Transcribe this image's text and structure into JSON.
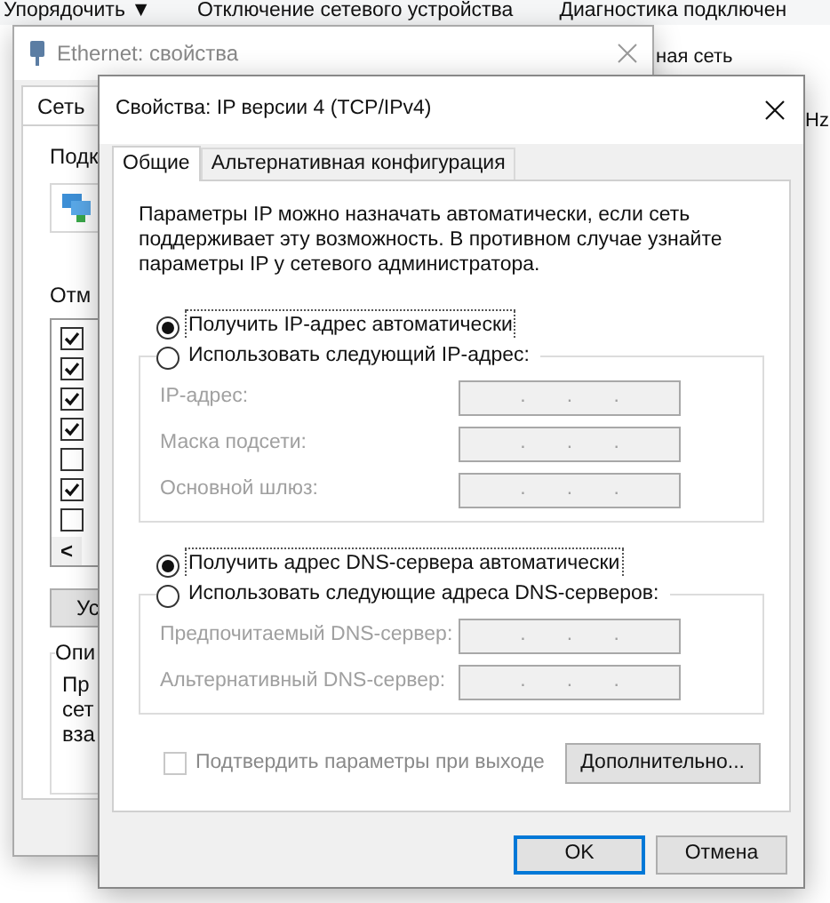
{
  "explorer": {
    "toolbar": [
      {
        "label": "Упорядочить ▼"
      },
      {
        "label": "Отключение сетевого устройства"
      },
      {
        "label": "Диагностика подключен"
      }
    ],
    "texts": [
      "ная сеть",
      "Hz"
    ]
  },
  "ethernet_window": {
    "title": "Ethernet: свойства",
    "tab": {
      "label": "Сеть",
      "selected": true
    },
    "connect_label": "Подк",
    "components_label": "Отм",
    "components": [
      {
        "checked": true
      },
      {
        "checked": true
      },
      {
        "checked": true
      },
      {
        "checked": true
      },
      {
        "checked": false
      },
      {
        "checked": true
      },
      {
        "checked": false
      }
    ],
    "scroll_left": "<",
    "button": "Ус",
    "group_label": "Опи",
    "description_lines": [
      "Пр",
      "сет",
      "вза"
    ]
  },
  "ipv4_dialog": {
    "title": "Свойства: IP версии 4 (TCP/IPv4)",
    "tabs": [
      {
        "label": "Общие",
        "selected": true
      },
      {
        "label": "Альтернативная конфигурация",
        "selected": false
      }
    ],
    "intro": "Параметры IP можно назначать автоматически, если сеть поддерживает эту возможность. В противном случае узнайте параметры IP у сетевого администратора.",
    "ip_mode": [
      {
        "label": "Получить IP-адрес автоматически",
        "selected": true
      },
      {
        "label": "Использовать следующий IP-адрес:",
        "selected": false
      }
    ],
    "ip_fields": [
      {
        "label": "IP-адрес:",
        "disabled": true,
        "separators": [
          ".",
          ".",
          "."
        ]
      },
      {
        "label": "Маска подсети:",
        "disabled": true,
        "separators": [
          ".",
          ".",
          "."
        ]
      },
      {
        "label": "Основной шлюз:",
        "disabled": true,
        "separators": [
          ".",
          ".",
          "."
        ]
      }
    ],
    "dns_mode": [
      {
        "label": "Получить адрес DNS-сервера автоматически",
        "selected": true
      },
      {
        "label": "Использовать следующие адреса DNS-серверов:",
        "selected": false
      }
    ],
    "dns_fields": [
      {
        "label": "Предпочитаемый DNS-сервер:",
        "disabled": true,
        "separators": [
          ".",
          ".",
          "."
        ]
      },
      {
        "label": "Альтернативный DNS-сервер:",
        "disabled": true,
        "separators": [
          ".",
          ".",
          "."
        ]
      }
    ],
    "validate": {
      "label": "Подтвердить параметры при выходе",
      "checked": false,
      "disabled": true
    },
    "advanced_button": "Дополнительно...",
    "buttons": [
      {
        "label": "OK",
        "default": true
      },
      {
        "label": "Отмена",
        "default": false
      }
    ]
  }
}
